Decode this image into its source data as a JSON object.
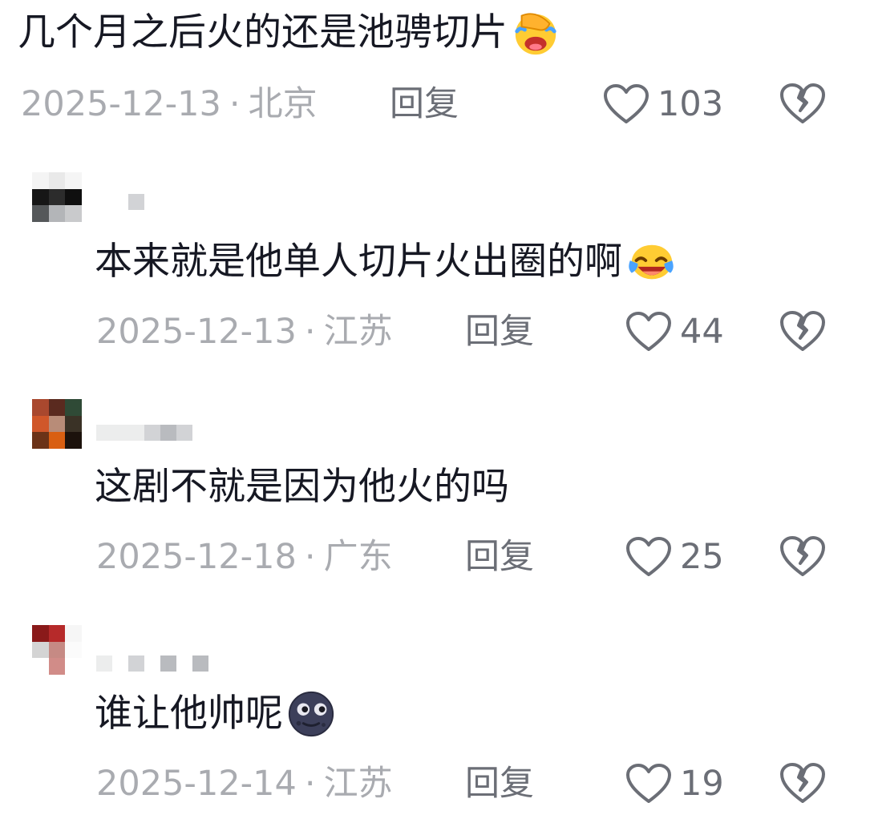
{
  "comments": [
    {
      "text": "几个月之后火的还是池骋切片",
      "emoji": "facepalm-crying-emoji",
      "date": "2025-12-13",
      "location": "北京",
      "reply_label": "回复",
      "likes": "103"
    },
    {
      "text": "本来就是他单人切片火出圈的啊",
      "emoji": "tears-of-joy-emoji",
      "date": "2025-12-13",
      "location": "江苏",
      "reply_label": "回复",
      "likes": "44"
    },
    {
      "text": "这剧不就是因为他火的吗",
      "emoji": "",
      "date": "2025-12-18",
      "location": "广东",
      "reply_label": "回复",
      "likes": "25"
    },
    {
      "text": "谁让他帅呢",
      "emoji": "new-moon-face-emoji",
      "date": "2025-12-14",
      "location": "江苏",
      "reply_label": "回复",
      "likes": "19"
    }
  ],
  "separator": "·",
  "icons": {
    "like": "heart-outline-icon",
    "dislike": "broken-heart-icon"
  },
  "colors": {
    "text": "#161823",
    "meta": "#a9abb0",
    "action": "#6b6e76"
  }
}
